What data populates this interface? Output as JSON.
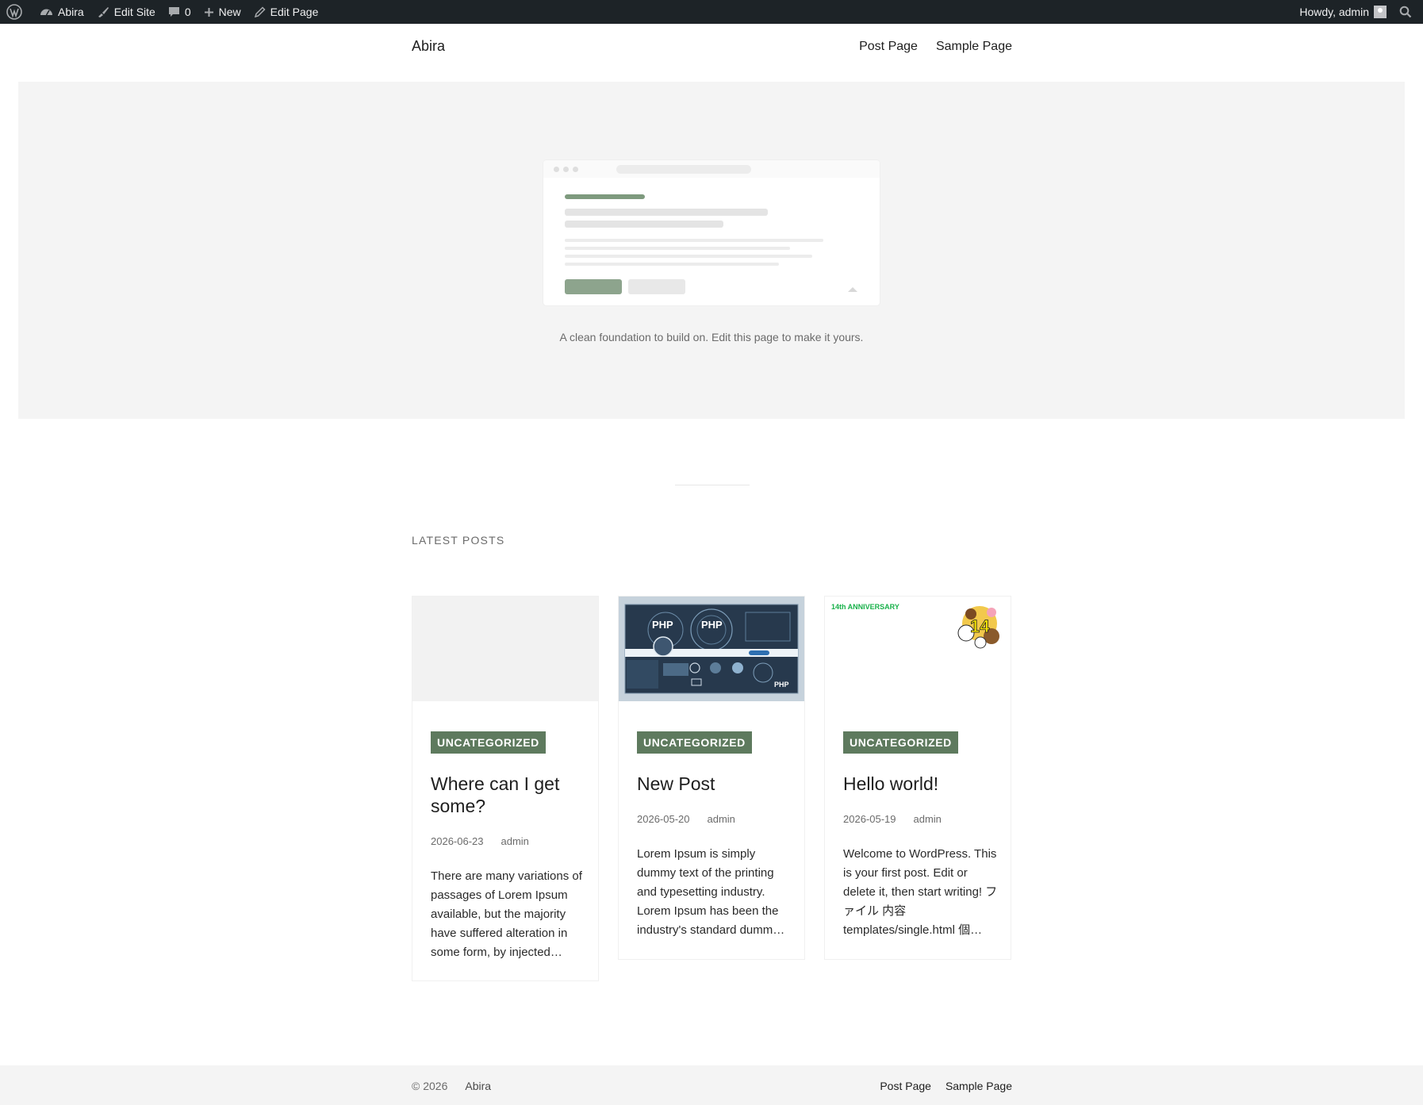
{
  "adminbar": {
    "site_name": "Abira",
    "edit_site": "Edit Site",
    "comments_count": "0",
    "new_label": "New",
    "edit_page": "Edit Page",
    "howdy": "Howdy, admin"
  },
  "header": {
    "site_title": "Abira",
    "nav": [
      "Post Page",
      "Sample Page"
    ]
  },
  "hero": {
    "caption": "A clean foundation to build on. Edit this page to make it yours."
  },
  "latest": {
    "label": "LATEST POSTS",
    "posts": [
      {
        "category": "UNCATEGORIZED",
        "title": "Where can I get some?",
        "date": "2026-06-23",
        "author": "admin",
        "excerpt": "There are many variations of passages of Lorem Ipsum available, but the majority have suffered alteration in some form, by injected…"
      },
      {
        "category": "UNCATEGORIZED",
        "title": "New Post",
        "date": "2026-05-20",
        "author": "admin",
        "excerpt": "Lorem Ipsum is simply dummy text of the printing and typesetting industry. Lorem Ipsum has been the industry's standard dumm…",
        "image_text": [
          "PHP",
          "PHP",
          "PHP"
        ]
      },
      {
        "category": "UNCATEGORIZED",
        "title": "Hello world!",
        "date": "2026-05-19",
        "author": "admin",
        "excerpt": "Welcome to WordPress. This is your first post. Edit or delete it, then start writing! ファイル 内容 templates/single.html 個…",
        "image_text": [
          "14th ANNIVERSARY",
          "14"
        ]
      }
    ]
  },
  "footer": {
    "copyright": "© 2026",
    "site": "Abira",
    "nav": [
      "Post Page",
      "Sample Page"
    ]
  },
  "colors": {
    "adminbar": "#1d2327",
    "accent": "#5e7a5e",
    "hero_bg": "#f4f4f4"
  }
}
